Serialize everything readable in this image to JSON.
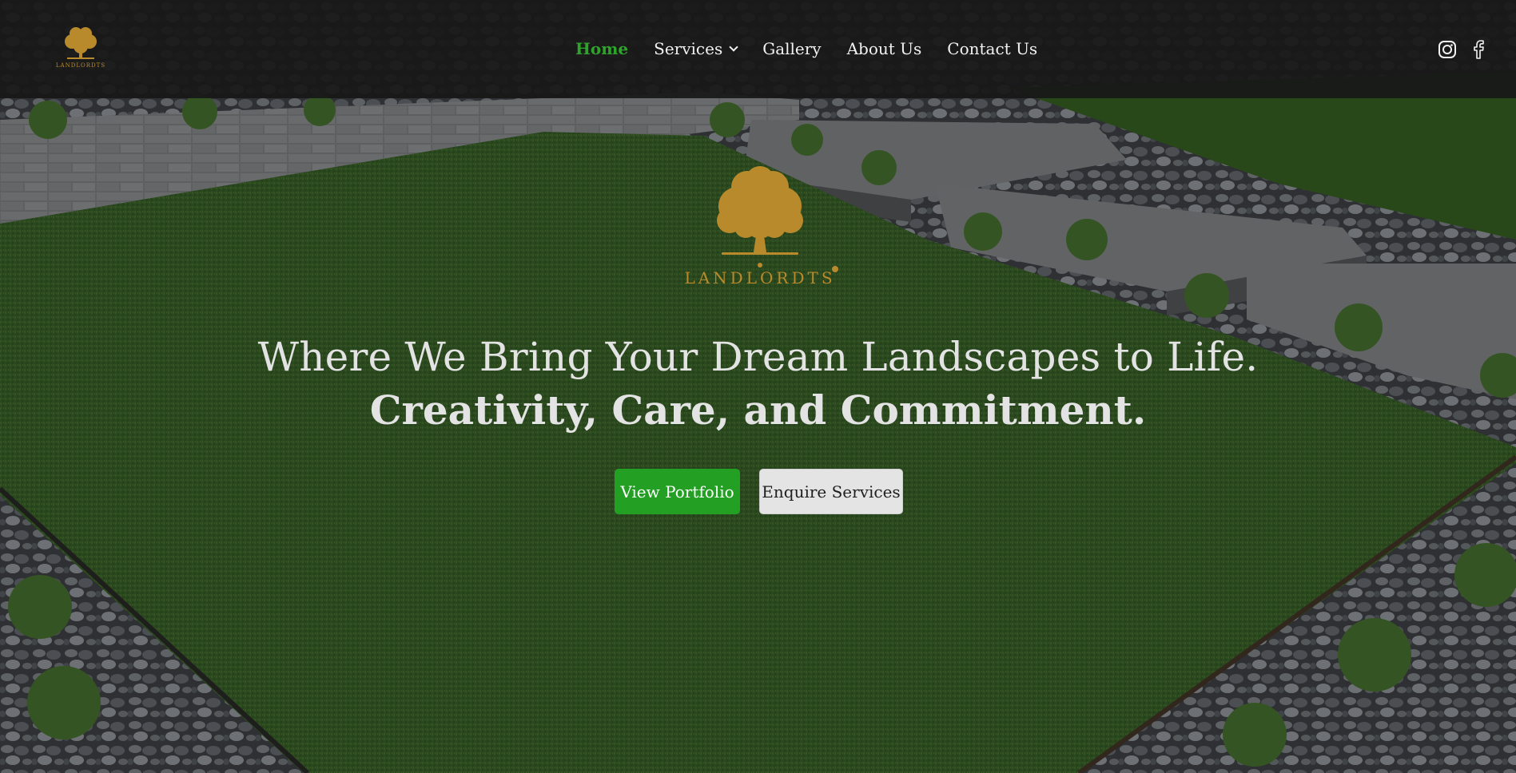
{
  "brand": {
    "name": "LANDLORDTS",
    "accent_color": "#b98a2c"
  },
  "nav": {
    "items": [
      {
        "label": "Home",
        "active": true
      },
      {
        "label": "Services",
        "has_dropdown": true
      },
      {
        "label": "Gallery"
      },
      {
        "label": "About Us"
      },
      {
        "label": "Contact Us"
      }
    ],
    "active_color": "#2ca52a",
    "social": [
      {
        "icon": "instagram-icon"
      },
      {
        "icon": "facebook-icon"
      }
    ]
  },
  "hero": {
    "headline_line1": "Where We Bring Your Dream Landscapes to Life.",
    "headline_line2": "Creativity, Care, and Commitment.",
    "primary_button": "View Portfolio",
    "secondary_button": "Enquire Services",
    "primary_color": "#23a024"
  }
}
